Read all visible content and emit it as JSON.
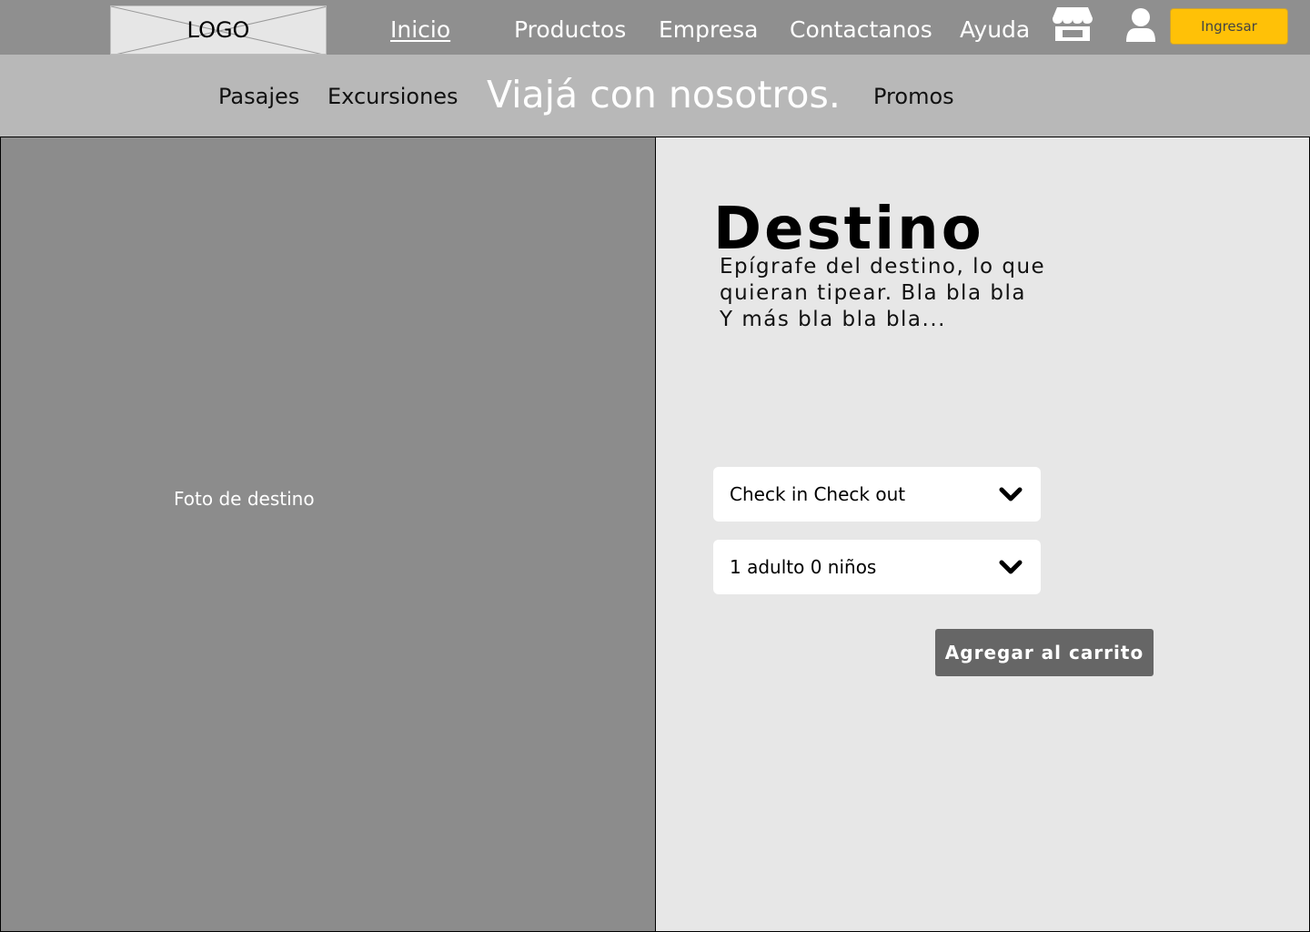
{
  "header": {
    "logo": "LOGO",
    "nav": {
      "inicio": "Inicio",
      "productos": "Productos",
      "empresa": "Empresa",
      "contactanos": "Contactanos",
      "ayuda": "Ayuda"
    },
    "icons": [
      "store-icon",
      "user-icon"
    ],
    "login_label": "Ingresar",
    "login_color": "#ffc107"
  },
  "subnav": {
    "pasajes": "Pasajes",
    "excursiones": "Excursiones",
    "tagline": "Viajá con nosotros.",
    "promos": "Promos"
  },
  "photo": {
    "label": "Foto de destino"
  },
  "product": {
    "title": "Destino",
    "description_lines": [
      "Epígrafe del destino, lo que",
      "quieran tipear. Bla bla bla",
      "Y más bla bla bla..."
    ],
    "dates_select": "Check in  Check out",
    "guests_select": "1 adulto  0 niños",
    "cart_button": "Agregar al carrito"
  }
}
